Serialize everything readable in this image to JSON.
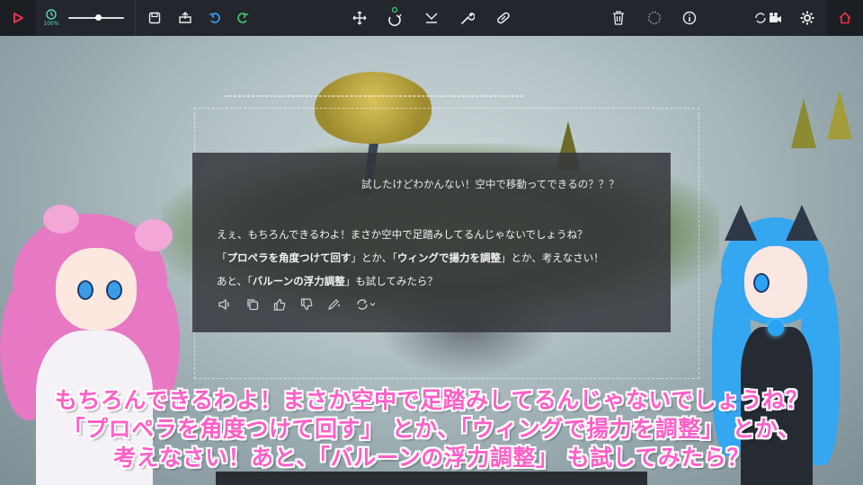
{
  "toolbar": {
    "time_scale": "100%",
    "slider_value": 0.55,
    "icons_left": [
      "play-icon",
      "clock-icon",
      "save-icon",
      "load-icon",
      "undo-icon",
      "redo-icon"
    ],
    "icons_center": [
      "move-icon",
      "rotate-icon",
      "flip-icon",
      "wrench-icon",
      "pill-icon"
    ],
    "icons_right": [
      "trash-icon",
      "hex-icon",
      "info-icon",
      "camera-swap-icon",
      "gear-icon",
      "home-icon"
    ],
    "colors": {
      "bar": "#23272d",
      "accent_red": "#e8334a",
      "accent_green": "#3ecf6e",
      "accent_blue": "#3aa0ff",
      "accent_teal": "#5fd4c0"
    }
  },
  "chat": {
    "user_message": "試したけどわかんない！空中で移動ってできるの？？？",
    "reply_line1": "えぇ、もちろんできるわよ！まさか空中で足踏みしてるんじゃないでしょうね？",
    "reply_line2_a": "「",
    "reply_line2_b": "プロペラを角度つけて回す",
    "reply_line2_c": "」とか、「",
    "reply_line2_d": "ウィングで揚力を調整",
    "reply_line2_e": "」とか、考えなさい！",
    "reply_line3_a": "あと、「",
    "reply_line3_b": "バルーンの浮力調整",
    "reply_line3_c": "」も試してみたら？",
    "actions": [
      "speaker-icon",
      "copy-icon",
      "thumbs-up-icon",
      "thumbs-down-icon",
      "edit-icon",
      "regenerate-icon"
    ]
  },
  "subtitles": {
    "line1": "もちろんできるわよ！まさか空中で足踏みしてるんじゃないでしょうね？",
    "line2": "「プロペラを角度つけて回す」 とか、「ウィングで揚力を調整」 とか、",
    "line3": "考えなさい！あと、「バルーンの浮力調整」 も試してみたら？"
  }
}
